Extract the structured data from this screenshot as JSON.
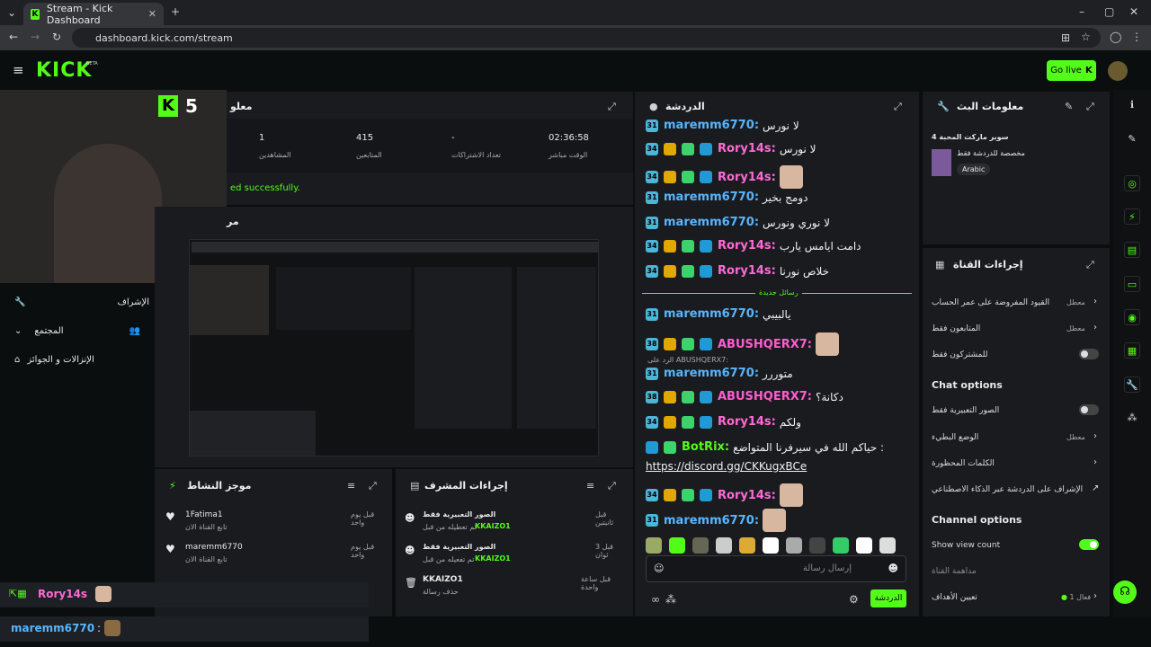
{
  "browser": {
    "tab_title": "Stream - Kick Dashboard",
    "url": "dashboard.kick.com/stream"
  },
  "header": {
    "logo": "KICK",
    "beta": "BETA",
    "go_live": "Go live"
  },
  "cam_overlay": {
    "level": "5"
  },
  "left_nav": {
    "items": [
      {
        "label": "الإشراف"
      },
      {
        "label": "المجتمع"
      },
      {
        "label": "الإنزالات و الجوائز"
      }
    ]
  },
  "stats_panel": {
    "title": "معلو",
    "stats": [
      {
        "value": "1",
        "label": "المشاهدين"
      },
      {
        "value": "415",
        "label": "المتابعين"
      },
      {
        "value": "-",
        "label": "تعداد الاشتراكات"
      },
      {
        "value": "02:36:58",
        "label": "الوقت مباشر"
      }
    ],
    "notice": "ed successfully.",
    "preview_title": "مر"
  },
  "activity_panel": {
    "title": "موجز النشاط",
    "items": [
      {
        "user": "1Fatima1",
        "sub": "تابع القناة الان",
        "time": "قبل يوم واحد"
      },
      {
        "user": "maremm6770",
        "sub": "تابع القناة الان",
        "time": "قبل يوم واحد"
      }
    ]
  },
  "mod_panel": {
    "title": "إجراءات المشرف",
    "items": [
      {
        "action": "الصور التعبيرية فقط",
        "sub": "تم تعطيله من قبل",
        "by": "KKAIZO1",
        "time": "قبل ثانيتين"
      },
      {
        "action": "الصور التعبيرية فقط",
        "sub": "تم تفعيله من قبل",
        "by": "KKAIZO1",
        "time": "قبل 3 ثوان"
      },
      {
        "action": "KKAIZO1",
        "sub": "حذف رسالة",
        "by": "",
        "time": "قبل ساعة واحدة"
      }
    ]
  },
  "chat_panel": {
    "title": "الدردشة",
    "messages": [
      {
        "badge": "31",
        "user": "maremm6770",
        "type": "mare",
        "text": "لا نورس"
      },
      {
        "badge": "34",
        "user": "Rory14s",
        "type": "rory",
        "text": "لا نورس"
      },
      {
        "badge": "34",
        "user": "Rory14s",
        "type": "rory",
        "text": ""
      },
      {
        "badge": "31",
        "user": "maremm6770",
        "type": "mare",
        "text": "دومج بخير"
      },
      {
        "badge": "31",
        "user": "maremm6770",
        "type": "mare",
        "text": "لا نوري ونورس"
      },
      {
        "badge": "34",
        "user": "Rory14s",
        "type": "rory",
        "text": "دامت ايامس يارب"
      },
      {
        "badge": "34",
        "user": "Rory14s",
        "type": "rory",
        "text": "خلاص نورنا"
      }
    ],
    "new_messages": "رسائل جديدة",
    "messages2": [
      {
        "badge": "31",
        "user": "maremm6770",
        "type": "mare",
        "text": "يالبيبي"
      },
      {
        "badge": "38",
        "user": "ABUSHQERX7",
        "type": "abu",
        "text": ""
      },
      {
        "badge": "31",
        "user": "maremm6770",
        "type": "mare",
        "text": "متوررر"
      },
      {
        "badge": "38",
        "user": "ABUSHQERX7",
        "type": "abu",
        "text": "دكانة؟"
      },
      {
        "badge": "34",
        "user": "Rory14s",
        "type": "rory",
        "text": "ولكم"
      }
    ],
    "reply_to": "الرد على ABUSHQERX7:",
    "bot": {
      "user": "BotRix",
      "text": "حياكم الله في سيرفرنا المتواضع :",
      "link": "https://discord.gg/CKKugxBCe"
    },
    "tail": [
      {
        "badge": "34",
        "user": "Rory14s",
        "type": "rory",
        "text": ""
      },
      {
        "badge": "31",
        "user": "maremm6770",
        "type": "mare",
        "text": ""
      }
    ],
    "input_placeholder": "إرسال رسالة",
    "send_label": "الدردشة"
  },
  "stream_info": {
    "title": "معلومات البث",
    "stream_title": "سوبر ماركت المحبة 4",
    "category": "مخصصة للدردشة فقط",
    "language": "Arabic"
  },
  "channel_actions": {
    "title": "إجراءات القناة",
    "rows": [
      {
        "label": "القيود المفروضة على عمر الحساب",
        "value": "معطل"
      },
      {
        "label": "المتابعون فقط",
        "value": "معطل"
      },
      {
        "label": "للمشتركون فقط",
        "value": ""
      }
    ],
    "chat_options_title": "Chat options",
    "chat_rows": [
      {
        "label": "الصور التعبيرية فقط",
        "value": ""
      },
      {
        "label": "الوضع البطيء",
        "value": "معطل"
      },
      {
        "label": "الكلمات المحظورة",
        "value": ""
      },
      {
        "label": "الإشراف على الدردشة عبر الذكاء الاصطناعي",
        "value": ""
      }
    ],
    "channel_options_title": "Channel options",
    "channel_rows": [
      {
        "label": "Show view count",
        "value": ""
      },
      {
        "label": "مداهمة القناة",
        "value": ""
      },
      {
        "label": "تعيين الأهداف",
        "value": "فعال 1"
      }
    ]
  },
  "overlay_chat": [
    {
      "user": "Rory14s",
      "type": "rory"
    },
    {
      "user": "maremm6770",
      "type": "mare"
    }
  ]
}
